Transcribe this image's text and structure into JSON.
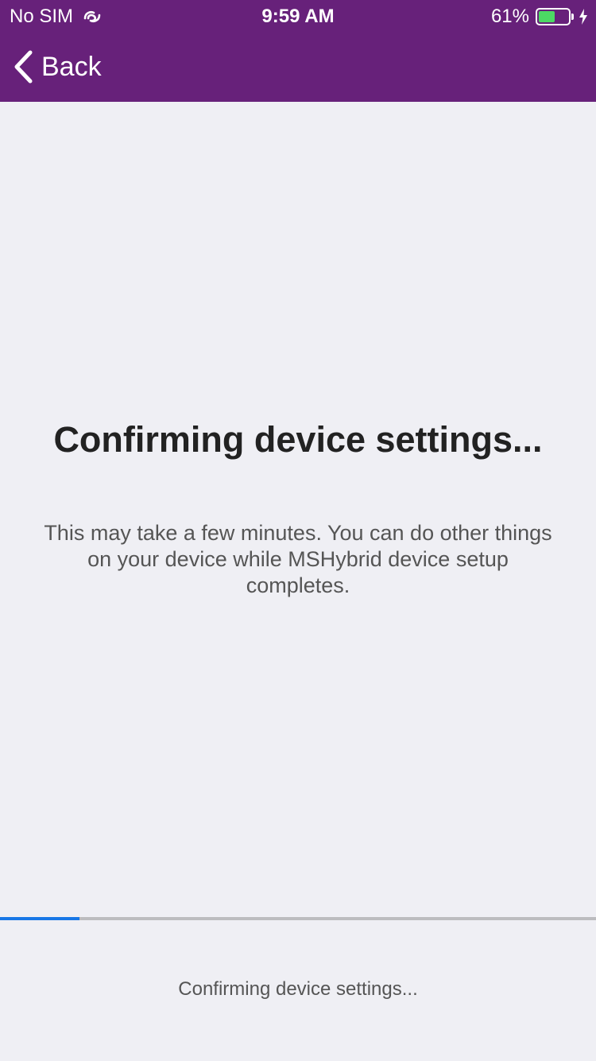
{
  "status_bar": {
    "carrier": "No SIM",
    "carrier_icon": "wifi-link-icon",
    "time": "9:59 AM",
    "battery_percent_text": "61%",
    "battery_level": 0.61,
    "battery_color": "#4cd964",
    "charging_icon": "bolt-icon"
  },
  "nav": {
    "back_label": "Back",
    "back_icon": "chevron-left-icon",
    "bar_color": "#67217a"
  },
  "main": {
    "title": "Confirming device settings...",
    "message": "This may take a few minutes.  You can do other things on your device while MSHybrid device setup completes."
  },
  "progress": {
    "value": 0.133,
    "fill_color": "#1877e6",
    "status_text": "Confirming device settings..."
  }
}
